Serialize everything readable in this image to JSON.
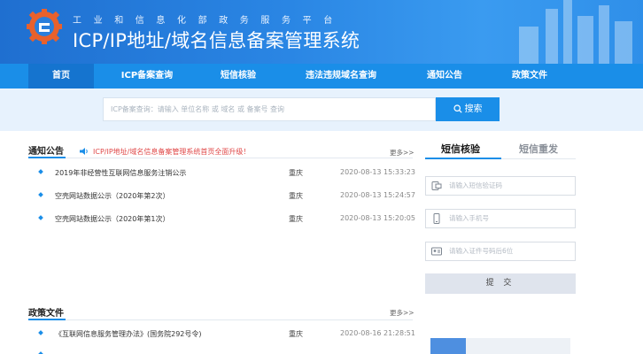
{
  "header": {
    "subtitle": "工业和信息化部政务服务平台",
    "title": "ICP/IP地址/域名信息备案管理系统"
  },
  "nav": {
    "items": [
      "首页",
      "ICP备案查询",
      "短信核验",
      "违法违规域名查询",
      "通知公告",
      "政策文件"
    ],
    "active_index": 0
  },
  "search": {
    "placeholder": "ICP备案查询：请输入 单位名称 或 域名 或 备案号 查询",
    "button": "搜索"
  },
  "notice": {
    "title": "通知公告",
    "scroll_text": "ICP/IP地址/域名信息备案管理系统首页全面升级！",
    "more": "更多>>",
    "rows": [
      {
        "title": "2019年非经营性互联网信息服务注销公示",
        "region": "重庆",
        "date": "2020-08-13 15:33:23"
      },
      {
        "title": "空壳网站数据公示（2020年第2次）",
        "region": "重庆",
        "date": "2020-08-13 15:24:57"
      },
      {
        "title": "空壳网站数据公示（2020年第1次）",
        "region": "重庆",
        "date": "2020-08-13 15:20:05"
      }
    ]
  },
  "policy": {
    "title": "政策文件",
    "more": "更多>>",
    "rows": [
      {
        "title": "《互联网信息服务管理办法》(国务院292号令)",
        "region": "重庆",
        "date": "2020-08-16 21:28:51"
      }
    ]
  },
  "sms": {
    "tab_active": "短信核验",
    "tab_inactive": "短信重发",
    "code_placeholder": "请输入短信验证码",
    "phone_placeholder": "请输入手机号",
    "id_placeholder": "请输入证件号码后6位",
    "submit": "提 交"
  },
  "colors": {
    "primary": "#1a8ee8",
    "nav_active": "#1574cf",
    "notice_red": "#e04848"
  }
}
